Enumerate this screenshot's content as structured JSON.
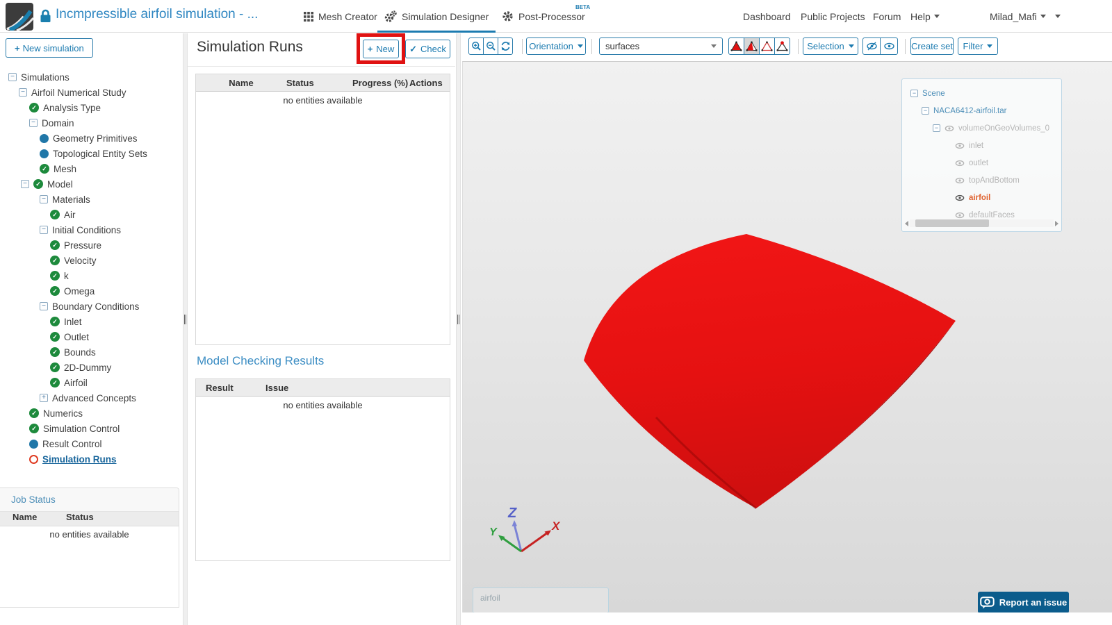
{
  "header": {
    "title": "Incmpressible airfoil simulation - ...",
    "tabs": [
      {
        "label": "Mesh Creator"
      },
      {
        "label": "Simulation Designer"
      },
      {
        "label": "Post-Processor",
        "badge": "BETA"
      }
    ],
    "links": [
      "Dashboard",
      "Public Projects",
      "Forum",
      "Help"
    ],
    "user": "Milad_Mafi"
  },
  "icons": {
    "collapse": "−",
    "expand": "+",
    "check": "✓",
    "plus": "+"
  },
  "sidebar": {
    "new_button": "New simulation",
    "tree": [
      {
        "label": "Simulations",
        "icon": "collapse",
        "level": 0
      },
      {
        "label": "Airfoil Numerical Study",
        "icon": "collapse",
        "level": 1
      },
      {
        "label": "Analysis Type",
        "icon": "check",
        "level": 2
      },
      {
        "label": "Domain",
        "icon": "collapse",
        "level": 2
      },
      {
        "label": "Geometry Primitives",
        "icon": "dot",
        "level": 3
      },
      {
        "label": "Topological Entity Sets",
        "icon": "dot",
        "level": 3
      },
      {
        "label": "Mesh",
        "icon": "check",
        "level": 3
      },
      {
        "label": "Model",
        "icon": "collapse+check",
        "level": 2
      },
      {
        "label": "Materials",
        "icon": "collapse",
        "level": 3
      },
      {
        "label": "Air",
        "icon": "check",
        "level": 4
      },
      {
        "label": "Initial Conditions",
        "icon": "collapse",
        "level": 3
      },
      {
        "label": "Pressure",
        "icon": "check",
        "level": 4
      },
      {
        "label": "Velocity",
        "icon": "check",
        "level": 4
      },
      {
        "label": "k",
        "icon": "check",
        "level": 4
      },
      {
        "label": "Omega",
        "icon": "check",
        "level": 4
      },
      {
        "label": "Boundary Conditions",
        "icon": "collapse",
        "level": 3
      },
      {
        "label": "Inlet",
        "icon": "check",
        "level": 4
      },
      {
        "label": "Outlet",
        "icon": "check",
        "level": 4
      },
      {
        "label": "Bounds",
        "icon": "check",
        "level": 4
      },
      {
        "label": "2D-Dummy",
        "icon": "check",
        "level": 4
      },
      {
        "label": "Airfoil",
        "icon": "check",
        "level": 4
      },
      {
        "label": "Advanced Concepts",
        "icon": "expand",
        "level": 3
      },
      {
        "label": "Numerics",
        "icon": "check",
        "level": 2
      },
      {
        "label": "Simulation Control",
        "icon": "check",
        "level": 2
      },
      {
        "label": "Result Control",
        "icon": "dot",
        "level": 2
      },
      {
        "label": "Simulation Runs",
        "icon": "ring",
        "level": 2,
        "selected": true
      }
    ],
    "job_status": {
      "title": "Job Status",
      "columns": [
        "Name",
        "Status"
      ],
      "empty": "no entities available"
    }
  },
  "runs": {
    "title": "Simulation Runs",
    "new_label": "New",
    "check_label": "Check",
    "table": {
      "columns": [
        "Name",
        "Status",
        "Progress (%)",
        "Actions"
      ],
      "empty": "no entities available"
    },
    "model_checking": {
      "title": "Model Checking Results",
      "columns": [
        "Result",
        "Issue"
      ],
      "empty": "no entities available"
    }
  },
  "viewport": {
    "toolbar": {
      "orientation": "Orientation",
      "surfaces": "surfaces",
      "selection": "Selection",
      "create_set": "Create set",
      "filter": "Filter"
    },
    "scene_tree": [
      {
        "label": "Scene",
        "style": "blue"
      },
      {
        "label": "NACA6412-airfoil.tar",
        "style": "blue"
      },
      {
        "label": "volumeOnGeoVolumes_0",
        "style": "gray"
      },
      {
        "label": "inlet",
        "style": "gray"
      },
      {
        "label": "outlet",
        "style": "gray"
      },
      {
        "label": "topAndBottom",
        "style": "gray"
      },
      {
        "label": "airfoil",
        "style": "orange-highlighted"
      },
      {
        "label": "defaultFaces",
        "style": "gray"
      }
    ],
    "axis": {
      "x": "X",
      "y": "Y",
      "z": "Z"
    },
    "note_text": "airfoil",
    "report_button": "Report an issue"
  },
  "colors": {
    "accent_blue": "#1c7bb0",
    "annotation_red": "#e01212",
    "airfoil_red": "#e81414",
    "highlight_orange": "#e0622f",
    "check_green": "#1d8a3c"
  }
}
